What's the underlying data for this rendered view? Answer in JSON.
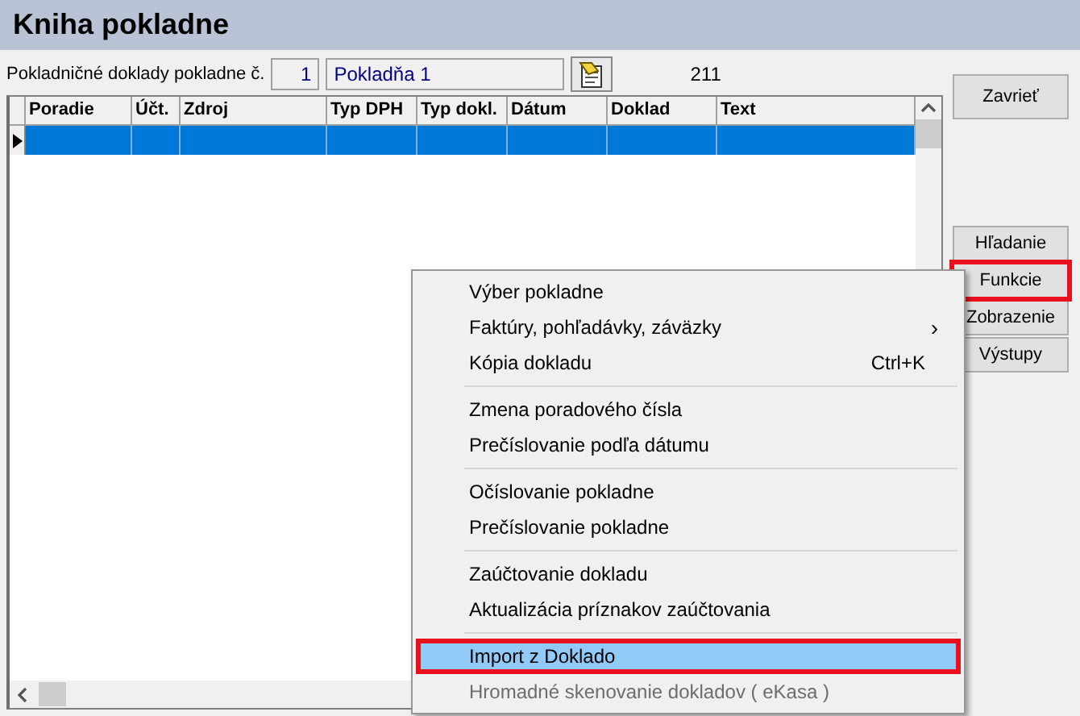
{
  "window": {
    "title": "Kniha pokladne"
  },
  "cash_register": {
    "label": "Pokladničné doklady pokladne č.",
    "number": "1",
    "name": "Pokladňa 1",
    "count": "211"
  },
  "table": {
    "columns": [
      {
        "label": "Poradie"
      },
      {
        "label": "Účt."
      },
      {
        "label": "Zdroj"
      },
      {
        "label": "Typ DPH"
      },
      {
        "label": "Typ dokl."
      },
      {
        "label": "Dátum"
      },
      {
        "label": "Doklad"
      },
      {
        "label": "Text"
      }
    ],
    "rows": [
      {
        "selected": true
      }
    ]
  },
  "buttons": [
    {
      "label": "Zavrieť",
      "highlighted": false
    },
    {
      "label": "Hľadanie",
      "highlighted": false
    },
    {
      "label": "Funkcie",
      "highlighted": true
    },
    {
      "label": "Zobrazenie",
      "highlighted": false
    },
    {
      "label": "Výstupy",
      "highlighted": false
    }
  ],
  "context_menu": {
    "groups": [
      [
        {
          "label": "Výber pokladne",
          "selected": false,
          "disabled": false,
          "highlighted": false
        },
        {
          "label": "Faktúry, pohľadávky, záväzky",
          "submenu": "›",
          "selected": false,
          "disabled": false,
          "highlighted": false
        },
        {
          "label": "Kópia dokladu",
          "shortcut": "Ctrl+K",
          "selected": false,
          "disabled": false,
          "highlighted": false
        }
      ],
      [
        {
          "label": "Zmena poradového čísla",
          "selected": false,
          "disabled": false,
          "highlighted": false
        },
        {
          "label": "Prečíslovanie podľa dátumu",
          "selected": false,
          "disabled": false,
          "highlighted": false
        }
      ],
      [
        {
          "label": "Očíslovanie pokladne",
          "selected": false,
          "disabled": false,
          "highlighted": false
        },
        {
          "label": "Prečíslovanie pokladne",
          "selected": false,
          "disabled": false,
          "highlighted": false
        }
      ],
      [
        {
          "label": "Zaúčtovanie dokladu",
          "selected": false,
          "disabled": false,
          "highlighted": false
        },
        {
          "label": "Aktualizácia príznakov zaúčtovania",
          "selected": false,
          "disabled": false,
          "highlighted": false
        }
      ],
      [
        {
          "label": "Import z Doklado",
          "selected": true,
          "disabled": false,
          "highlighted": true
        },
        {
          "label": "Hromadné skenovanie dokladov ( eKasa )",
          "selected": false,
          "disabled": true,
          "highlighted": false
        }
      ]
    ]
  }
}
